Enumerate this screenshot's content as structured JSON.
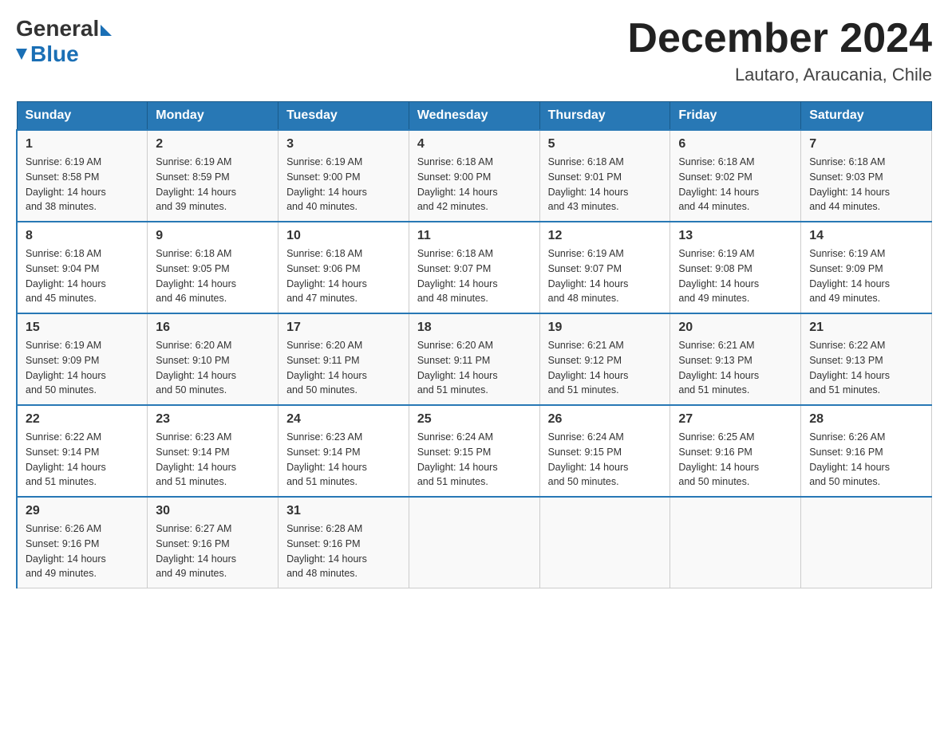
{
  "logo": {
    "general": "General",
    "blue": "Blue",
    "subtitle": "Blue"
  },
  "header": {
    "title": "December 2024",
    "subtitle": "Lautaro, Araucania, Chile"
  },
  "days_of_week": [
    "Sunday",
    "Monday",
    "Tuesday",
    "Wednesday",
    "Thursday",
    "Friday",
    "Saturday"
  ],
  "weeks": [
    [
      {
        "day": "1",
        "sunrise": "6:19 AM",
        "sunset": "8:58 PM",
        "daylight": "14 hours and 38 minutes."
      },
      {
        "day": "2",
        "sunrise": "6:19 AM",
        "sunset": "8:59 PM",
        "daylight": "14 hours and 39 minutes."
      },
      {
        "day": "3",
        "sunrise": "6:19 AM",
        "sunset": "9:00 PM",
        "daylight": "14 hours and 40 minutes."
      },
      {
        "day": "4",
        "sunrise": "6:18 AM",
        "sunset": "9:00 PM",
        "daylight": "14 hours and 42 minutes."
      },
      {
        "day": "5",
        "sunrise": "6:18 AM",
        "sunset": "9:01 PM",
        "daylight": "14 hours and 43 minutes."
      },
      {
        "day": "6",
        "sunrise": "6:18 AM",
        "sunset": "9:02 PM",
        "daylight": "14 hours and 44 minutes."
      },
      {
        "day": "7",
        "sunrise": "6:18 AM",
        "sunset": "9:03 PM",
        "daylight": "14 hours and 44 minutes."
      }
    ],
    [
      {
        "day": "8",
        "sunrise": "6:18 AM",
        "sunset": "9:04 PM",
        "daylight": "14 hours and 45 minutes."
      },
      {
        "day": "9",
        "sunrise": "6:18 AM",
        "sunset": "9:05 PM",
        "daylight": "14 hours and 46 minutes."
      },
      {
        "day": "10",
        "sunrise": "6:18 AM",
        "sunset": "9:06 PM",
        "daylight": "14 hours and 47 minutes."
      },
      {
        "day": "11",
        "sunrise": "6:18 AM",
        "sunset": "9:07 PM",
        "daylight": "14 hours and 48 minutes."
      },
      {
        "day": "12",
        "sunrise": "6:19 AM",
        "sunset": "9:07 PM",
        "daylight": "14 hours and 48 minutes."
      },
      {
        "day": "13",
        "sunrise": "6:19 AM",
        "sunset": "9:08 PM",
        "daylight": "14 hours and 49 minutes."
      },
      {
        "day": "14",
        "sunrise": "6:19 AM",
        "sunset": "9:09 PM",
        "daylight": "14 hours and 49 minutes."
      }
    ],
    [
      {
        "day": "15",
        "sunrise": "6:19 AM",
        "sunset": "9:09 PM",
        "daylight": "14 hours and 50 minutes."
      },
      {
        "day": "16",
        "sunrise": "6:20 AM",
        "sunset": "9:10 PM",
        "daylight": "14 hours and 50 minutes."
      },
      {
        "day": "17",
        "sunrise": "6:20 AM",
        "sunset": "9:11 PM",
        "daylight": "14 hours and 50 minutes."
      },
      {
        "day": "18",
        "sunrise": "6:20 AM",
        "sunset": "9:11 PM",
        "daylight": "14 hours and 51 minutes."
      },
      {
        "day": "19",
        "sunrise": "6:21 AM",
        "sunset": "9:12 PM",
        "daylight": "14 hours and 51 minutes."
      },
      {
        "day": "20",
        "sunrise": "6:21 AM",
        "sunset": "9:13 PM",
        "daylight": "14 hours and 51 minutes."
      },
      {
        "day": "21",
        "sunrise": "6:22 AM",
        "sunset": "9:13 PM",
        "daylight": "14 hours and 51 minutes."
      }
    ],
    [
      {
        "day": "22",
        "sunrise": "6:22 AM",
        "sunset": "9:14 PM",
        "daylight": "14 hours and 51 minutes."
      },
      {
        "day": "23",
        "sunrise": "6:23 AM",
        "sunset": "9:14 PM",
        "daylight": "14 hours and 51 minutes."
      },
      {
        "day": "24",
        "sunrise": "6:23 AM",
        "sunset": "9:14 PM",
        "daylight": "14 hours and 51 minutes."
      },
      {
        "day": "25",
        "sunrise": "6:24 AM",
        "sunset": "9:15 PM",
        "daylight": "14 hours and 51 minutes."
      },
      {
        "day": "26",
        "sunrise": "6:24 AM",
        "sunset": "9:15 PM",
        "daylight": "14 hours and 50 minutes."
      },
      {
        "day": "27",
        "sunrise": "6:25 AM",
        "sunset": "9:16 PM",
        "daylight": "14 hours and 50 minutes."
      },
      {
        "day": "28",
        "sunrise": "6:26 AM",
        "sunset": "9:16 PM",
        "daylight": "14 hours and 50 minutes."
      }
    ],
    [
      {
        "day": "29",
        "sunrise": "6:26 AM",
        "sunset": "9:16 PM",
        "daylight": "14 hours and 49 minutes."
      },
      {
        "day": "30",
        "sunrise": "6:27 AM",
        "sunset": "9:16 PM",
        "daylight": "14 hours and 49 minutes."
      },
      {
        "day": "31",
        "sunrise": "6:28 AM",
        "sunset": "9:16 PM",
        "daylight": "14 hours and 48 minutes."
      },
      null,
      null,
      null,
      null
    ]
  ],
  "labels": {
    "sunrise": "Sunrise:",
    "sunset": "Sunset:",
    "daylight": "Daylight:"
  }
}
